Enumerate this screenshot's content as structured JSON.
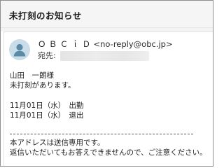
{
  "email": {
    "subject": "未打刻のお知らせ",
    "sender_name": "ＯＢＣｉＤ",
    "sender_email": "<no-reply@obc.jp>",
    "to_label": "宛先:",
    "recipient_name": "山田　一朗様",
    "message": "未打刻があります。",
    "entries": [
      "11月01日（水）　出勤",
      "11月01日（水）　退出"
    ],
    "footer_line1": "本アドレスは送信専用です。",
    "footer_line2": "返信いただいてもお答えできませんので、ご注意ください。"
  },
  "colors": {
    "avatar_bg": "#c9dde9",
    "avatar_fg": "#5b8aa6"
  },
  "icons": {
    "avatar": "person-icon"
  }
}
